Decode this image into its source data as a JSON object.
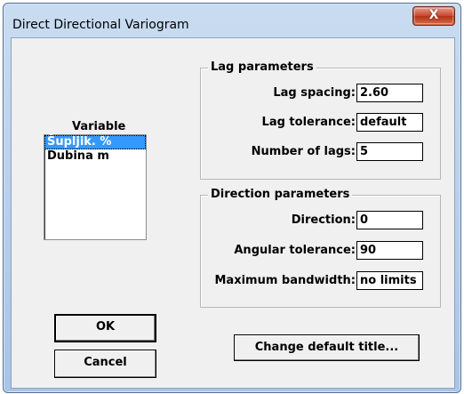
{
  "window": {
    "title": "Direct Directional Variogram",
    "close_glyph": "X"
  },
  "variable": {
    "label": "Variable",
    "items": [
      "Šupljik. %",
      "Dubina m"
    ],
    "selected_index": 0
  },
  "lag": {
    "title": "Lag parameters",
    "spacing_label": "Lag spacing:",
    "spacing_value": "2.60",
    "tolerance_label": "Lag tolerance:",
    "tolerance_value": "default",
    "count_label": "Number of lags:",
    "count_value": "5"
  },
  "direction": {
    "title": "Direction parameters",
    "direction_label": "Direction:",
    "direction_value": "0",
    "angular_label": "Angular tolerance:",
    "angular_value": "90",
    "bandwidth_label": "Maximum bandwidth:",
    "bandwidth_value": "no limits"
  },
  "buttons": {
    "ok": "OK",
    "cancel": "Cancel",
    "change_title": "Change default title..."
  },
  "colors": {
    "selection": "#3399ff",
    "close_button": "#c9452f",
    "dialog_face": "#f0f0f0"
  }
}
